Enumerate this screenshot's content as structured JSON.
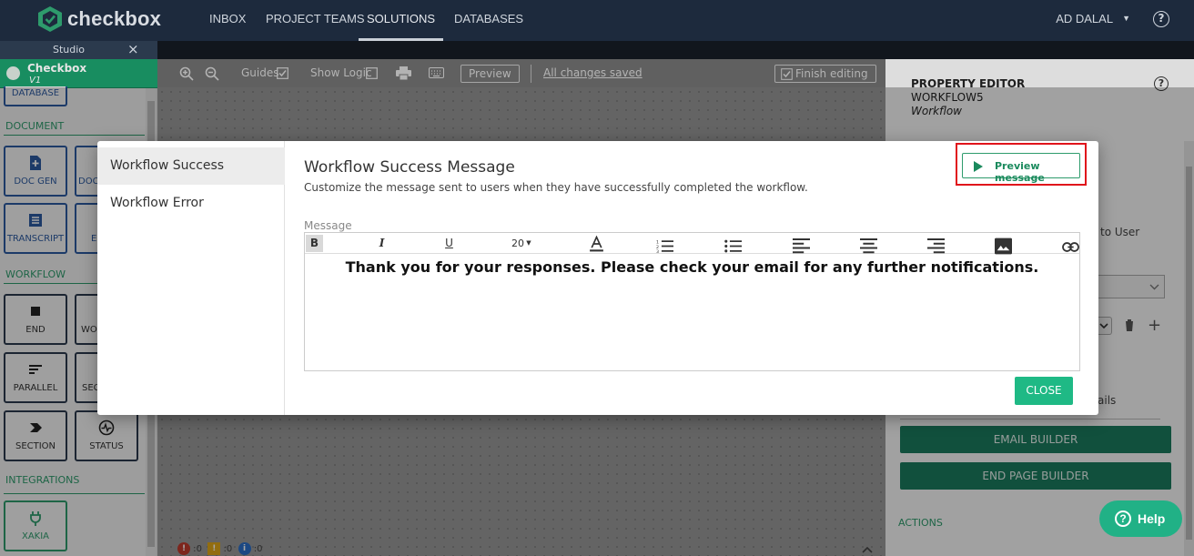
{
  "app": {
    "logo_text": "checkbox",
    "nav": [
      "INBOX",
      "PROJECT TEAMS",
      "SOLUTIONS",
      "DATABASES"
    ],
    "active_nav": "SOLUTIONS",
    "user": "AD DALAL",
    "help_glyph": "?"
  },
  "studio": {
    "tab_label": "Studio",
    "close_glyph": "×",
    "app_name": "Checkbox",
    "version": "V1"
  },
  "palette": {
    "partial_top": "DATABASE",
    "sections": {
      "document": "DOCUMENT",
      "workflow": "WORKFLOW",
      "integrations": "INTEGRATIONS"
    },
    "items": {
      "doc_gen": "DOC GEN",
      "doc2": "DOC",
      "transcript": "TRANSCRIPT",
      "e": "E",
      "end": "END",
      "wo": "WO",
      "parallel": "PARALLEL",
      "sec": "SEC",
      "section": "SECTION",
      "status": "STATUS",
      "xakia": "XAKIA"
    }
  },
  "toolbar": {
    "guides": "Guides",
    "show_logic": "Show Logic",
    "preview": "Preview",
    "saved": "All changes saved",
    "finish": "Finish editing"
  },
  "property_editor": {
    "title": "PROPERTY EDITOR",
    "item": "WORKFLOW5",
    "type": "Workflow",
    "partial_text": "to User",
    "partial_text2": "ails",
    "email_builder": "EMAIL BUILDER",
    "end_page_builder": "END PAGE BUILDER",
    "actions": "ACTIONS"
  },
  "status_counts": {
    "errors": "0",
    "warnings": "0",
    "info": "0"
  },
  "modal": {
    "nav": [
      "Workflow Success",
      "Workflow Error"
    ],
    "active": "Workflow Success",
    "title": "Workflow Success Message",
    "subtitle": "Customize the message sent to users when they have successfully completed the workflow.",
    "preview_button": "Preview message",
    "message_label": "Message",
    "font_size": "20",
    "message_body": "Thank you for your responses. Please check your email for any further notifications.",
    "close_button": "CLOSE"
  },
  "help_fab": "Help",
  "colors": {
    "nav_bg": "#1d2a3d",
    "brand_green": "#1b9e6b",
    "button_green": "#1fb985",
    "highlight_red": "#e0141b"
  }
}
